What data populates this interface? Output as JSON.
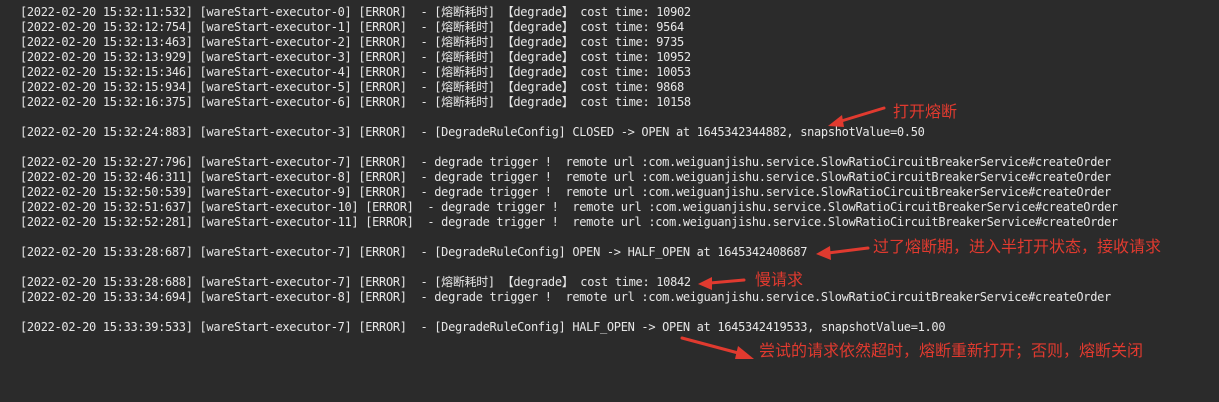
{
  "log_lines": [
    "[2022-02-20 15:32:11:532] [wareStart-executor-0] [ERROR]  - [熔断耗时] 【degrade】 cost time: 10902",
    "[2022-02-20 15:32:12:754] [wareStart-executor-1] [ERROR]  - [熔断耗时] 【degrade】 cost time: 9564",
    "[2022-02-20 15:32:13:463] [wareStart-executor-2] [ERROR]  - [熔断耗时] 【degrade】 cost time: 9735",
    "[2022-02-20 15:32:13:929] [wareStart-executor-3] [ERROR]  - [熔断耗时] 【degrade】 cost time: 10952",
    "[2022-02-20 15:32:15:346] [wareStart-executor-4] [ERROR]  - [熔断耗时] 【degrade】 cost time: 10053",
    "[2022-02-20 15:32:15:934] [wareStart-executor-5] [ERROR]  - [熔断耗时] 【degrade】 cost time: 9868",
    "[2022-02-20 15:32:16:375] [wareStart-executor-6] [ERROR]  - [熔断耗时] 【degrade】 cost time: 10158",
    "[2022-02-20 15:32:24:883] [wareStart-executor-3] [ERROR]  - [DegradeRuleConfig] CLOSED -> OPEN at 1645342344882, snapshotValue=0.50",
    "[2022-02-20 15:32:27:796] [wareStart-executor-7] [ERROR]  - degrade trigger !  remote url :com.weiguanjishu.service.SlowRatioCircuitBreakerService#createOrder",
    "[2022-02-20 15:32:46:311] [wareStart-executor-8] [ERROR]  - degrade trigger !  remote url :com.weiguanjishu.service.SlowRatioCircuitBreakerService#createOrder",
    "[2022-02-20 15:32:50:539] [wareStart-executor-9] [ERROR]  - degrade trigger !  remote url :com.weiguanjishu.service.SlowRatioCircuitBreakerService#createOrder",
    "[2022-02-20 15:32:51:637] [wareStart-executor-10] [ERROR]  - degrade trigger !  remote url :com.weiguanjishu.service.SlowRatioCircuitBreakerService#createOrder",
    "[2022-02-20 15:32:52:281] [wareStart-executor-11] [ERROR]  - degrade trigger !  remote url :com.weiguanjishu.service.SlowRatioCircuitBreakerService#createOrder",
    "[2022-02-20 15:33:28:687] [wareStart-executor-7] [ERROR]  - [DegradeRuleConfig] OPEN -> HALF_OPEN at 1645342408687",
    "[2022-02-20 15:33:28:688] [wareStart-executor-7] [ERROR]  - [熔断耗时] 【degrade】 cost time: 10842",
    "[2022-02-20 15:33:34:694] [wareStart-executor-8] [ERROR]  - degrade trigger !  remote url :com.weiguanjishu.service.SlowRatioCircuitBreakerService#createOrder",
    "[2022-02-20 15:33:39:533] [wareStart-executor-7] [ERROR]  - [DegradeRuleConfig] HALF_OPEN -> OPEN at 1645342419533, snapshotValue=1.00"
  ],
  "annotations": {
    "open_breaker": "打开熔断",
    "half_open": "过了熔断期，进入半打开状态，接收请求",
    "slow_request": "慢请求",
    "reopen_or_close": "尝试的请求依然超时，熔断重新打开；否则，熔断关闭"
  },
  "colors": {
    "background": "#2b2b2b",
    "text": "#e6e6e6",
    "annotation": "#e03a2f"
  }
}
